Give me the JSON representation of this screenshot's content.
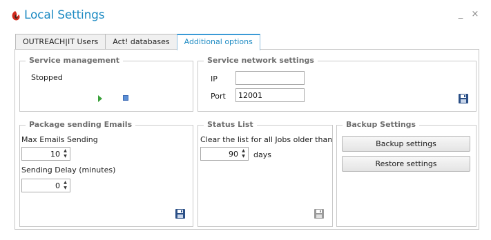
{
  "window": {
    "title": "Local Settings",
    "minimize_glyph": "_",
    "close_glyph": "×"
  },
  "tabs": [
    {
      "label": "OUTREACH|IT Users"
    },
    {
      "label": "Act! databases"
    },
    {
      "label": "Additional options"
    }
  ],
  "service_management": {
    "title": "Service management",
    "status": "Stopped",
    "start_icon": "play-icon",
    "stop_icon": "stop-icon"
  },
  "service_network": {
    "title": "Service network settings",
    "ip_label": "IP",
    "ip_value": "",
    "port_label": "Port",
    "port_value": "12001",
    "save_icon": "save-icon"
  },
  "package_emails": {
    "title": "Package sending Emails",
    "max_label": "Max Emails Sending",
    "max_value": "10",
    "delay_label": "Sending Delay (minutes)",
    "delay_value": "0",
    "save_icon": "save-icon"
  },
  "status_list": {
    "title": "Status List",
    "clear_label": "Clear the list for all Jobs older than",
    "days_value": "90",
    "days_unit": "days",
    "save_icon": "save-icon"
  },
  "backup": {
    "title": "Backup Settings",
    "backup_button": "Backup settings",
    "restore_button": "Restore settings"
  },
  "colors": {
    "accent": "#1e8bc3",
    "group_title": "#6e6e6e",
    "save_active": "#2a4f86",
    "save_disabled": "#9a9a9a"
  }
}
